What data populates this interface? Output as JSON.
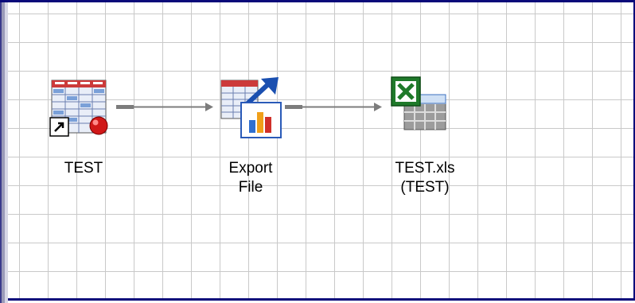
{
  "flow": {
    "nodes": [
      {
        "label": "TEST",
        "icon": "table-shortcut-icon"
      },
      {
        "label_line1": "Export",
        "label_line2": "File",
        "icon": "export-file-icon"
      },
      {
        "label_line1": "TEST.xls",
        "label_line2": "(TEST)",
        "icon": "excel-file-icon"
      }
    ],
    "colors": {
      "grid": "#c9c9c9",
      "border": "#0a0a7a",
      "connector": "#7c7c7c",
      "table_header": "#cc3a3a",
      "excel_green": "#1f7a2a"
    }
  }
}
